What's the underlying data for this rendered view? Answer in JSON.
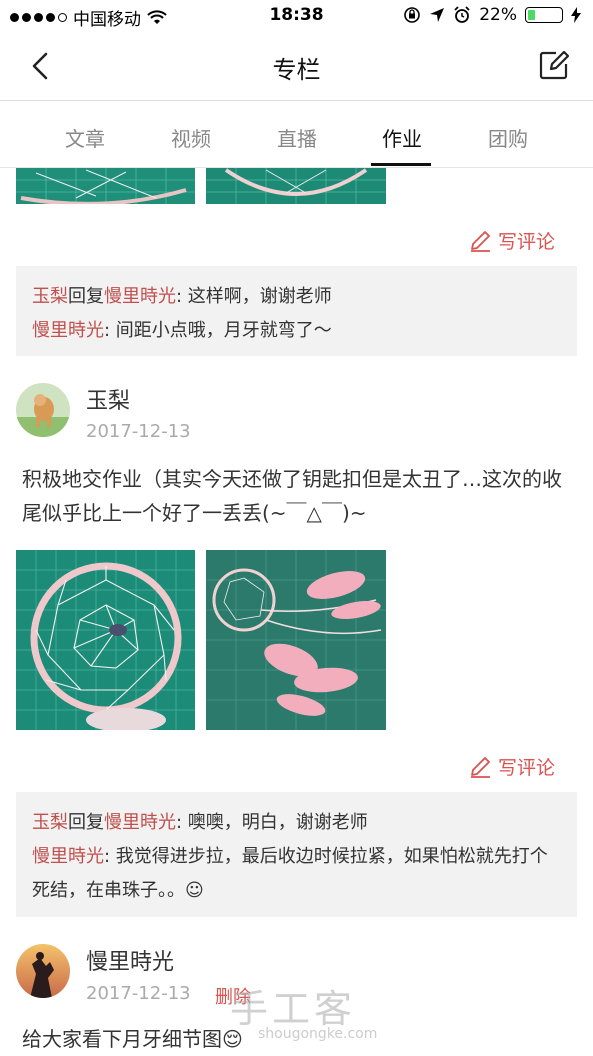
{
  "status_bar": {
    "carrier": "中国移动",
    "time": "18:38",
    "battery": "22%",
    "battery_level": 0.22,
    "icons": [
      "signal-dots",
      "wifi-icon",
      "rotation-lock-icon",
      "location-icon",
      "alarm-icon",
      "battery-icon",
      "charging-icon"
    ]
  },
  "header": {
    "title": "专栏",
    "back_icon": "chevron-left-icon",
    "edit_icon": "edit-icon"
  },
  "tabs": [
    {
      "label": "文章",
      "active": false
    },
    {
      "label": "视频",
      "active": false
    },
    {
      "label": "直播",
      "active": false
    },
    {
      "label": "作业",
      "active": true
    },
    {
      "label": "团购",
      "active": false
    }
  ],
  "posts": [
    {
      "reply_button": "写评论",
      "comments": [
        {
          "author": "玉梨",
          "reply_word": "回复",
          "target": "慢里時光",
          "text": ": 这样啊，谢谢老师"
        },
        {
          "author": "慢里時光",
          "text": ": 间距小点哦，月牙就弯了～"
        }
      ]
    },
    {
      "user": "玉梨",
      "date": "2017-12-13",
      "content": "积极地交作业（其实今天还做了钥匙扣但是太丑了…这次的收尾似乎比上一个好了一丢丢(~￣△￣)~",
      "reply_button": "写评论",
      "comments": [
        {
          "author": "玉梨",
          "reply_word": "回复",
          "target": "慢里時光",
          "text": ": 噢噢，明白，谢谢老师"
        },
        {
          "author": "慢里時光",
          "text": ": 我觉得进步拉，最后收边时候拉紧，如果怕松就先打个死结，在串珠子。。☺"
        }
      ]
    },
    {
      "user": "慢里時光",
      "date": "2017-12-13",
      "delete_label": "删除",
      "content": "给大家看下月牙细节图😌"
    }
  ],
  "watermark": {
    "text": "手工客",
    "sub": "shougongke.com"
  }
}
